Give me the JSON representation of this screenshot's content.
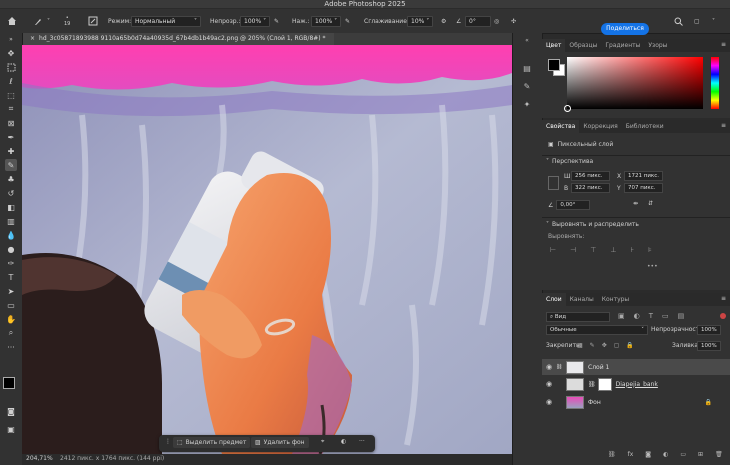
{
  "app": {
    "title": "Adobe Photoshop 2025"
  },
  "options_bar": {
    "brush_size": "19",
    "mode_label": "Режим:",
    "mode_value": "Нормальный",
    "opacity_label": "Непрозр.:",
    "opacity_value": "100%",
    "pressure_label": "Наж.:",
    "pressure_value": "100%",
    "smoothing_label": "Сглаживание:",
    "smoothing_value": "10%",
    "angle_value": "0°",
    "share_label": "Поделиться"
  },
  "document": {
    "tab_title": "hd_3c05871893988 9110a65b0d74a40935d_67b4db1b49ac2.png @ 205% (Слой 1, RGB/8#) *",
    "zoom": "204,71%",
    "doc_info": "2412 пикс. x 1764 пикс. (144 ppi)"
  },
  "context_bar": {
    "select_subject": "Выделить предмет",
    "remove_bg": "Удалить фон",
    "more": "···"
  },
  "color_panel": {
    "tabs": [
      "Цвет",
      "Образцы",
      "Градиенты",
      "Узоры"
    ],
    "active_tab": "Цвет"
  },
  "properties_panel": {
    "tabs": [
      "Свойства",
      "Коррекция",
      "Библиотеки"
    ],
    "layer_kind": "Пиксельный слой",
    "transform_title": "Перспектива",
    "w_label": "Ш",
    "w_value": "256 пикс.",
    "h_label": "В",
    "h_value": "322 пикс.",
    "x_label": "X",
    "x_value": "1721 пикс.",
    "y_label": "Y",
    "y_value": "707 пикс.",
    "angle_value": "0,00°",
    "align_title": "Выровнять и распределить",
    "align_label": "Выровнять:",
    "more": "•••"
  },
  "layers_panel": {
    "tabs": [
      "Слои",
      "Каналы",
      "Контуры"
    ],
    "filter_kind": "Вид",
    "blend_mode": "Обычные",
    "opacity_label": "Непрозрачность:",
    "opacity_value": "100%",
    "lock_label": "Закрепить:",
    "fill_label": "Заливка:",
    "fill_value": "100%",
    "layers": [
      {
        "name": "Слой 1"
      },
      {
        "name": "Diapejia_bank"
      },
      {
        "name": "Фон"
      }
    ],
    "footer_fx": "fx"
  },
  "colors": {
    "accent": "#1473e6",
    "hue_red": "#ff0000"
  }
}
